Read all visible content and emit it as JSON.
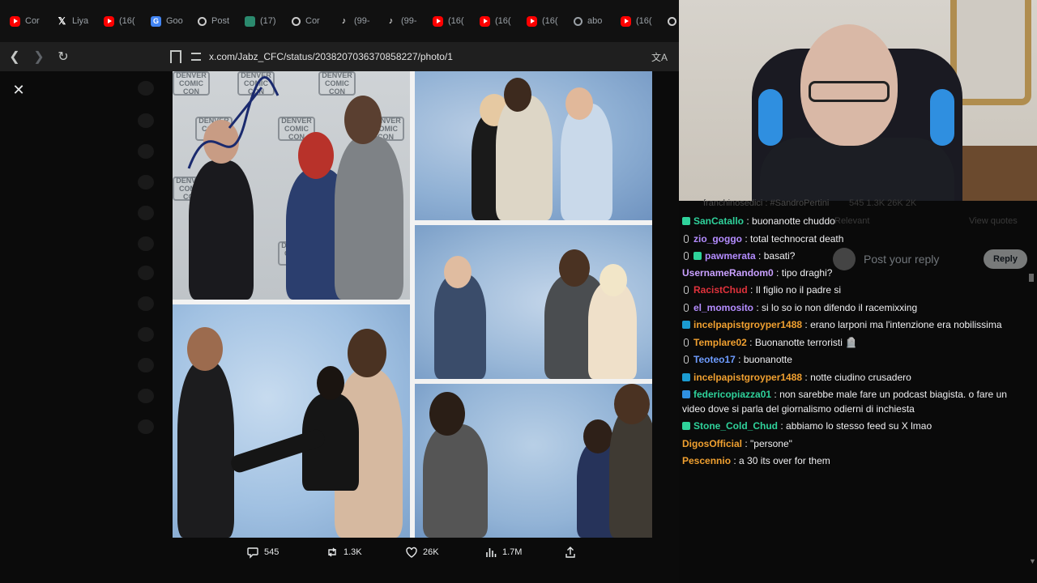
{
  "tabs": [
    {
      "icon": "youtube-icon",
      "cls": "yt",
      "label": "Cor"
    },
    {
      "icon": "x-icon",
      "cls": "x",
      "label": "Liya"
    },
    {
      "icon": "youtube-icon",
      "cls": "yt",
      "label": "(16("
    },
    {
      "icon": "google-icon",
      "cls": "g",
      "label": "Goo"
    },
    {
      "icon": "threads-icon",
      "cls": "o",
      "label": "Post"
    },
    {
      "icon": "whatsapp-icon",
      "cls": "w",
      "label": "(17)"
    },
    {
      "icon": "threads-icon",
      "cls": "o",
      "label": "Cor"
    },
    {
      "icon": "tiktok-icon",
      "cls": "tt",
      "label": "(99-"
    },
    {
      "icon": "tiktok-icon",
      "cls": "tt",
      "label": "(99-"
    },
    {
      "icon": "youtube-icon",
      "cls": "yt",
      "label": "(16("
    },
    {
      "icon": "youtube-icon",
      "cls": "yt",
      "label": "(16("
    },
    {
      "icon": "youtube-icon",
      "cls": "yt",
      "label": "(16("
    },
    {
      "icon": "globe-icon",
      "cls": "globe",
      "label": "abo"
    },
    {
      "icon": "youtube-icon",
      "cls": "yt",
      "label": "(16("
    },
    {
      "icon": "threads-icon",
      "cls": "o",
      "label": ""
    }
  ],
  "toolbar": {
    "url": "x.com/Jabz_CFC/status/2038207036370858227/photo/1"
  },
  "photo": {
    "panel_logo": "DENVER COMIC CON"
  },
  "actions": {
    "replies": "545",
    "reposts": "1.3K",
    "likes": "26K",
    "views": "1.7M"
  },
  "chat": {
    "ghost_top": "franchinosedici : #SandroPertini",
    "ghost_stats": "545   1.3K   26K   2K",
    "ghost_relevant": "Relevant",
    "ghost_view_quotes": "View quotes",
    "reply_placeholder": "Post your reply",
    "reply_button": "Reply",
    "messages": [
      {
        "user": "SanCatallo",
        "color": "#2fd29b",
        "badge": "sub",
        "text": "buonanotte chuddo"
      },
      {
        "user": "zio_goggo",
        "color": "#b48cff",
        "badge": "mic",
        "text": "total technocrat death"
      },
      {
        "user": "pawmerata",
        "color": "#b48cff",
        "badge": "mic-sub",
        "text": "basati?"
      },
      {
        "user": "UsernameRandom0",
        "color": "#c9a0ff",
        "badge": "",
        "text": "tipo draghi?"
      },
      {
        "user": "RacistChud",
        "color": "#e0323c",
        "badge": "mic",
        "text": "Il figlio no il padre si"
      },
      {
        "user": "el_momosito",
        "color": "#b48cff",
        "badge": "mic",
        "text": "si lo so io non difendo il racemixxing"
      },
      {
        "user": "incelpapistgroyper1488",
        "color": "#f0a030",
        "badge": "prime",
        "text": "erano larponi ma l'intenzione era nobilissima"
      },
      {
        "user": "Templare02",
        "color": "#f0a030",
        "badge": "mic",
        "text": "Buonanotte terroristi 🪦"
      },
      {
        "user": "Teoteo17",
        "color": "#6e9cff",
        "badge": "mic",
        "text": "buonanotte"
      },
      {
        "user": "incelpapistgroyper1488",
        "color": "#f0a030",
        "badge": "prime",
        "text": "notte ciudino crusadero"
      },
      {
        "user": "federicopiazza01",
        "color": "#2fd29b",
        "badge": "vip",
        "text": "non sarebbe male fare un podcast biagista. o fare un video dove si parla del giornalismo odierni di inchiesta"
      },
      {
        "user": "Stone_Cold_Chud",
        "color": "#2fd29b",
        "badge": "sub",
        "text": "abbiamo lo stesso feed su X lmao"
      },
      {
        "user": "DigosOfficial",
        "color": "#f0a030",
        "badge": "",
        "text": "\"persone\""
      },
      {
        "user": "Pescennio",
        "color": "#f0a030",
        "badge": "",
        "text": "a 30 its over for them"
      }
    ]
  }
}
